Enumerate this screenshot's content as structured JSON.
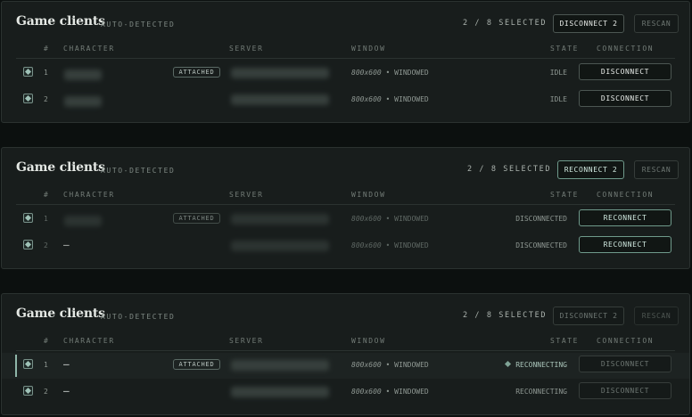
{
  "panels": [
    {
      "title": "Game clients",
      "subtitle": "AUTO-DETECTED",
      "selection": "2 / 8 SELECTED",
      "primary_action": "DISCONNECT 2",
      "secondary_action": "RESCAN",
      "columns": [
        "#",
        "CHARACTER",
        "SERVER",
        "WINDOW",
        "STATE",
        "CONNECTION"
      ],
      "rows": [
        {
          "num": "1",
          "badge": "ATTACHED",
          "window_res": "800x600",
          "window_mode": "• WINDOWED",
          "state": "IDLE",
          "action": "DISCONNECT"
        },
        {
          "num": "2",
          "window_res": "800x600",
          "window_mode": "• WINDOWED",
          "state": "IDLE",
          "action": "DISCONNECT"
        }
      ]
    },
    {
      "title": "Game clients",
      "subtitle": "AUTO-DETECTED",
      "selection": "2 / 8 SELECTED",
      "primary_action": "RECONNECT 2",
      "secondary_action": "RESCAN",
      "columns": [
        "#",
        "CHARACTER",
        "SERVER",
        "WINDOW",
        "STATE",
        "CONNECTION"
      ],
      "rows": [
        {
          "num": "1",
          "badge": "ATTACHED",
          "window_res": "800x600",
          "window_mode": "• WINDOWED",
          "state": "DISCONNECTED",
          "action": "RECONNECT"
        },
        {
          "num": "2",
          "character": "—",
          "window_res": "800x600",
          "window_mode": "• WINDOWED",
          "state": "DISCONNECTED",
          "action": "RECONNECT"
        }
      ]
    },
    {
      "title": "Game clients",
      "subtitle": "AUTO-DETECTED",
      "selection": "2 / 8 SELECTED",
      "primary_action": "DISCONNECT 2",
      "secondary_action": "RESCAN",
      "columns": [
        "#",
        "CHARACTER",
        "SERVER",
        "WINDOW",
        "STATE",
        "CONNECTION"
      ],
      "rows": [
        {
          "num": "1",
          "character": "—",
          "badge": "ATTACHED",
          "window_res": "800x600",
          "window_mode": "• WINDOWED",
          "state": "RECONNECTING",
          "action": "DISCONNECT"
        },
        {
          "num": "2",
          "character": "—",
          "window_res": "800x600",
          "window_mode": "• WINDOWED",
          "state": "RECONNECTING",
          "action": "DISCONNECT"
        }
      ]
    }
  ],
  "colors": {
    "background": "#0c100f",
    "panel": "#181d1c",
    "accent": "#8fb6a9"
  }
}
